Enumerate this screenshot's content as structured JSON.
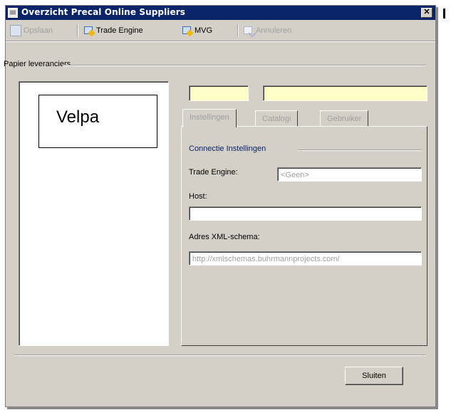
{
  "window": {
    "title": "Overzicht Precal Online Suppliers",
    "close_glyph": "✕"
  },
  "toolbar": {
    "save_label": "Opslaan",
    "trade_engine_label": "Trade Engine",
    "mvg_label": "MVG",
    "cancel_label": "Annuleren"
  },
  "group": {
    "label": "Papier leveranciers"
  },
  "supplier_list": {
    "selected": "Velpa"
  },
  "tabs": [
    {
      "label": "Instellingen",
      "active": true
    },
    {
      "label": "Catalogi",
      "active": false
    },
    {
      "label": "Gebruiker",
      "active": false
    }
  ],
  "connection": {
    "group_label": "Connectie Instellingen",
    "trade_engine_label": "Trade Engine:",
    "trade_engine_value": "<Geen>",
    "host_label": "Host:",
    "host_value": "",
    "xml_label": "Adres XML-schema:",
    "xml_value": "http://xmlschemas.buhrmannprojects.com/"
  },
  "footer": {
    "close_label": "Sluiten"
  },
  "icons": {
    "title": "form-icon",
    "save": "save-icon",
    "trade_engine": "trade-engine-icon",
    "mvg": "mvg-icon",
    "cancel": "cancel-icon"
  },
  "colors": {
    "titlebar": "#0a246a",
    "window_bg": "#d4d0c8",
    "field_yellow": "#ffffc8",
    "disabled_text": "#a0a0a0"
  }
}
